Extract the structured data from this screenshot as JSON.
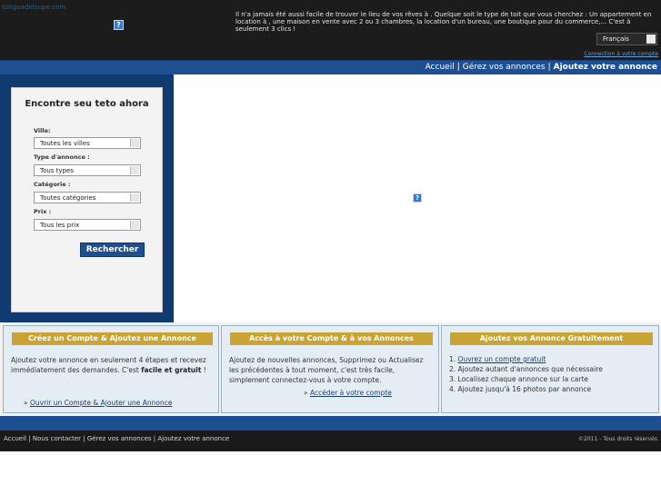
{
  "header": {
    "site_link": "toitguadeloupe.com",
    "tagline": "Il n'a jamais été aussi facile de trouver le lieu de vos rêves à . Quelque soit le type de toit que vous cherchez : Un appartement en location à , une maison en vente avec 2 ou 3 chambres, la location d'un bureau, une boutique pour du commerce,... C'est à seulement 3 clics !",
    "language": "Français",
    "login_link": "Connection à votre compte",
    "image_placeholder": "?"
  },
  "nav": {
    "home": "Accueil",
    "separator": "|",
    "manage": "Gérez vos annonces",
    "add": "Ajoutez votre annonce"
  },
  "search": {
    "title": "Encontre seu teto ahora",
    "city_label": "Ville:",
    "city_value": "Toutes les villes",
    "type_label": "Type d'annonce :",
    "type_value": "Tous types",
    "category_label": "Catégorie :",
    "category_value": "Toutes catégories",
    "price_label": "Prix :",
    "price_value": "Tous les prix",
    "button": "Rechercher"
  },
  "main": {
    "image_placeholder": "?"
  },
  "boxes": [
    {
      "title": "Créez un Compte & Ajoutez une Annonce",
      "text_1": "Ajoutez votre annonce en seulement 4 étapes et recevez immédiatement des demandes. C'est",
      "text_bold": "facile et gratuit",
      "text_2": "!",
      "link_prefix": "»",
      "link": "Ouvrir un Compte & Ajouter une Annonce"
    },
    {
      "title": "Accès à votre Compte & à vos Annonces",
      "text": "Ajoutez de nouvelles annonces, Supprimez ou Actualisez les précédentes à tout moment, c'est très facile, simplement connectez-vous à votre compte.",
      "link_prefix": "»",
      "link": "Accéder à votre compte"
    },
    {
      "title": "Ajoutez vos Annonce Gratuitement",
      "items": [
        {
          "num": "1.",
          "text": "Ouvrez un compte gratuit"
        },
        {
          "num": "2.",
          "text": "Ajoutez autant d'annonces que nécessaire"
        },
        {
          "num": "3.",
          "text": "Localisez chaque annonce sur la carte"
        },
        {
          "num": "4.",
          "text": "Ajoutez jusqu'à 16 photos par annonce"
        }
      ]
    }
  ],
  "footer": {
    "home": "Accueil",
    "contact": "Nous contacter",
    "manage": "Gérez vos annonces",
    "add": "Ajoutez votre annonce",
    "separator": "|",
    "copyright": "©2011 - Tous droits réservés"
  },
  "colors": {
    "header_bg": "#1c1c1c",
    "nav_blue": "#1e4f91",
    "left_panel": "#103a70",
    "box_gold": "#c9a435",
    "box_bg": "#e4edf3"
  }
}
